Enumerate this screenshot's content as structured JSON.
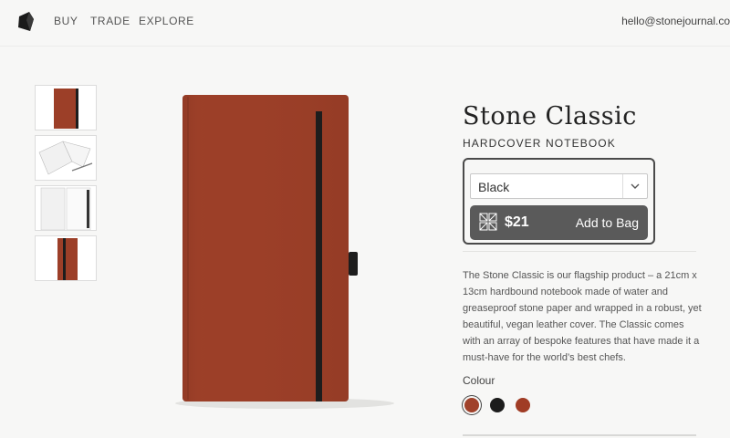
{
  "nav": {
    "logo": "stone-logo",
    "items": [
      "BUY",
      "TRADE",
      "EXPLORE"
    ],
    "email": "hello@stonejournal.co"
  },
  "product": {
    "title": "Stone Classic",
    "subtitle": "HARDCOVER NOTEBOOK",
    "selected_colour": "Black",
    "price": "$21",
    "add_to_bag": "Add to Bag",
    "description": "The Stone Classic is our flagship product – a 21cm x 13cm hardbound notebook made of water and greaseproof stone paper and wrapped in a robust, yet beautiful, vegan leather cover. The Classic comes with an array of bespoke features that have made it a must-have for the world’s best chefs.",
    "colour_label": "Colour",
    "swatches": [
      {
        "name": "rust",
        "color": "#a0412a",
        "selected": true
      },
      {
        "name": "black",
        "color": "#1c1c1c",
        "selected": false
      },
      {
        "name": "red-brown",
        "color": "#a03c25",
        "selected": false
      }
    ]
  },
  "colors": {
    "cover": "#9c3f28",
    "band": "#1d1d1d",
    "button": "#5a5a5a"
  }
}
